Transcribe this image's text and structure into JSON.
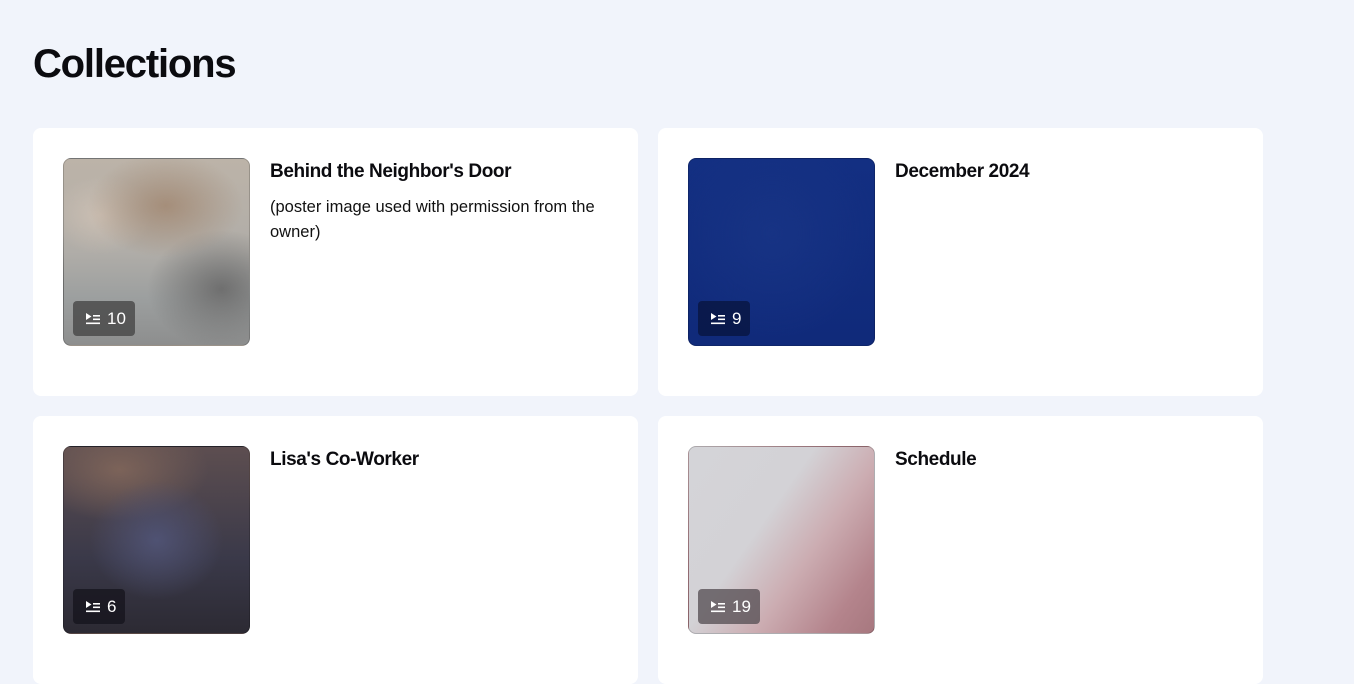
{
  "page": {
    "title": "Collections"
  },
  "collections": [
    {
      "title": "Behind the Neighbor's Door",
      "description": "(poster image used with permission from the owner)",
      "count": "10",
      "icon": "playlist-icon"
    },
    {
      "title": "December 2024",
      "description": "",
      "count": "9",
      "icon": "playlist-icon"
    },
    {
      "title": "Lisa's Co-Worker",
      "description": "",
      "count": "6",
      "icon": "playlist-icon"
    },
    {
      "title": "Schedule",
      "description": "",
      "count": "19",
      "icon": "playlist-icon"
    }
  ]
}
